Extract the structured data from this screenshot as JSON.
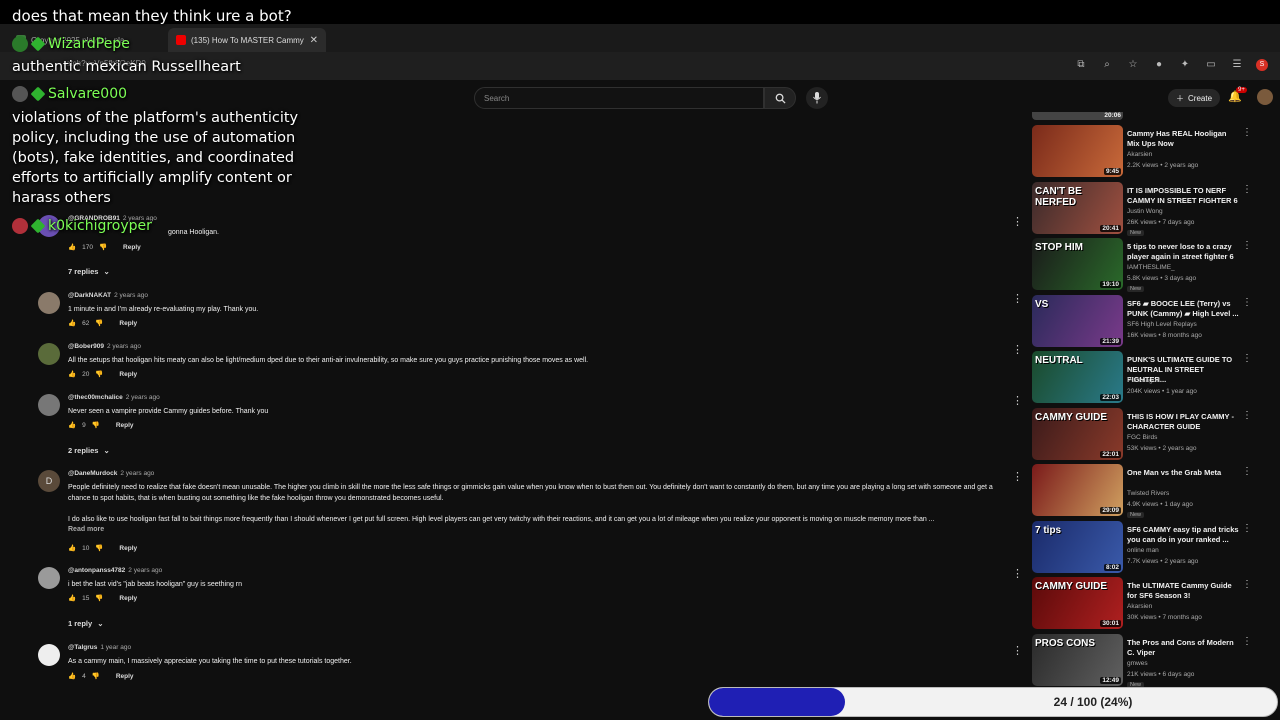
{
  "browser": {
    "tabs": [
      {
        "title": "Groyper 2025 playlist - pla"
      },
      {
        "title": "(135) How To MASTER Cammy",
        "close": "✕"
      }
    ],
    "new_tab": "+",
    "url": "atch?v=Vn5fb8QeKD0"
  },
  "header": {
    "search_placeholder": "Search",
    "create_label": "Create",
    "notifications": "9+"
  },
  "comments": [
    {
      "user": "@GRANDROB91",
      "time": "2 years ago",
      "text": "gonna Hooligan.",
      "likes": "170",
      "reply": "Reply",
      "replies": "7 replies",
      "color": "#6a4fb3"
    },
    {
      "user": "@DarkNAKAT",
      "time": "2 years ago",
      "text": "1 minute in and I'm already re-evaluating my play. Thank you.",
      "likes": "62",
      "reply": "Reply",
      "color": "#8a7a6a"
    },
    {
      "user": "@Bober909",
      "time": "2 years ago",
      "text": "All the setups that hooligan hits meaty can also be light/medium dped due to their anti-air invulnerability, so make sure you guys practice punishing those moves as well.",
      "likes": "20",
      "reply": "Reply",
      "color": "#5a6b3a"
    },
    {
      "user": "@thec00mchalice",
      "time": "2 years ago",
      "text": "Never seen a vampire provide Cammy guides before. Thank you",
      "likes": "9",
      "reply": "Reply",
      "replies": "2 replies",
      "color": "#777"
    },
    {
      "user": "@DaneMurdock",
      "time": "2 years ago",
      "initial": "D",
      "text": "People definitely need to realize that fake doesn't mean unusable. The higher you climb in skill the more the less safe things or gimmicks gain value when you know when to bust them out. You definitely don't want to constantly do them, but any time you are playing a long set with someone and get a chance to spot habits, that is when busting out something like the fake hooligan throw you demonstrated becomes useful.",
      "text2": "I do also like to use hooligan fast fall to bait things more frequently than I should whenever I get put full screen. High level players can get very twitchy with their reactions, and it can get you a lot of mileage when you realize your opponent is moving on muscle memory more than ...",
      "read_more": "Read more",
      "likes": "10",
      "reply": "Reply",
      "color": "#5a4a3a"
    },
    {
      "user": "@antonpanss4782",
      "time": "2 years ago",
      "text": "i bet the last vid's \"jab beats hooligan\" guy is seething rn",
      "likes": "15",
      "reply": "Reply",
      "replies": "1 reply",
      "color": "#9a9a9a"
    },
    {
      "user": "@Talgrus",
      "time": "1 year ago",
      "text": "As a cammy main, I massively appreciate you taking the time to put these tutorials together.",
      "likes": "4",
      "reply": "Reply",
      "color": "#eeeeee"
    }
  ],
  "sidebar": {
    "top_partial_duration": "20:06",
    "videos": [
      {
        "title": "Cammy Has REAL Hooligan Mix Ups Now",
        "channel": "Akarsien",
        "meta": "2.2K views • 2 years ago",
        "duration": "9:45",
        "thumb_colors": [
          "#7a2a1a",
          "#c96a3a"
        ],
        "thumb_text": ""
      },
      {
        "title": "IT IS IMPOSSIBLE TO NERF CAMMY IN STREET FIGHTER 6",
        "channel": "Justin Wong",
        "meta": "26K views • 7 days ago",
        "badge": "New",
        "duration": "20:41",
        "thumb_colors": [
          "#3a2a2a",
          "#a05040"
        ],
        "thumb_text": "CAN'T BE NERFED"
      },
      {
        "title": "5 tips to never lose to a crazy player again in street fighter 6",
        "channel": "IAMTHESLIME_",
        "meta": "5.8K views • 3 days ago",
        "badge": "New",
        "duration": "19:10",
        "thumb_colors": [
          "#1a1a1a",
          "#2a6a2a"
        ],
        "thumb_text": "STOP HIM"
      },
      {
        "title": "SF6 ▰ BOOCE LEE (Terry) vs PUNK (Cammy) ▰ High Level ...",
        "channel": "SF6 High Level Replays",
        "meta": "16K views • 8 months ago",
        "duration": "21:39",
        "thumb_colors": [
          "#2a2a5a",
          "#7a3a8a"
        ],
        "thumb_text": "VS"
      },
      {
        "title": "PUNK'S ULTIMATE GUIDE TO NEUTRAL IN STREET FIGHTER...",
        "channel": "Punkdagod",
        "meta": "204K views • 1 year ago",
        "duration": "22:03",
        "thumb_colors": [
          "#1a4a2a",
          "#2a7a8a"
        ],
        "thumb_text": "NEUTRAL"
      },
      {
        "title": "THIS IS HOW I PLAY CAMMY - CHARACTER GUIDE",
        "channel": "FGC Birds",
        "meta": "53K views • 2 years ago",
        "duration": "22:01",
        "thumb_colors": [
          "#3a1a1a",
          "#8a3a2a"
        ],
        "thumb_text": "CAMMY GUIDE"
      },
      {
        "title": "One Man vs the Grab Meta",
        "channel": "Twisted Rivers",
        "meta": "4.9K views • 1 day ago",
        "badge": "New",
        "duration": "29:09",
        "thumb_colors": [
          "#7a1a1a",
          "#d0a060"
        ],
        "thumb_text": ""
      },
      {
        "title": "SF6 CAMMY easy tip and tricks you can do in your ranked ...",
        "channel": "online man",
        "meta": "7.7K views • 2 years ago",
        "duration": "8:02",
        "thumb_colors": [
          "#1a2a6a",
          "#3a5aaa"
        ],
        "thumb_text": "7 tips"
      },
      {
        "title": "The ULTIMATE Cammy Guide for SF6 Season 3!",
        "channel": "Akarsien",
        "meta": "30K views • 7 months ago",
        "duration": "30:01",
        "thumb_colors": [
          "#5a0a0a",
          "#b02020"
        ],
        "thumb_text": "CAMMY GUIDE"
      },
      {
        "title": "The Pros and Cons of Modern C. Viper",
        "channel": "gmwes",
        "meta": "21K views • 6 days ago",
        "badge": "New",
        "duration": "12:49",
        "thumb_colors": [
          "#2a2a2a",
          "#606060"
        ],
        "thumb_text": "PROS CONS"
      }
    ]
  },
  "overlay": {
    "question": "does that mean they think ure a bot?",
    "user1": "WizardPepe",
    "msg1": "authentic mexican Russellheart",
    "user2": "Salvare000",
    "msg2": "violations of the platform's authenticity policy, including the use of automation (bots), fake identities, and coordinated efforts to artificially amplify content or harass others",
    "user3": "k0kichigroyper"
  },
  "progress": {
    "label": "24 / 100 (24%)",
    "fraction": 0.24
  }
}
